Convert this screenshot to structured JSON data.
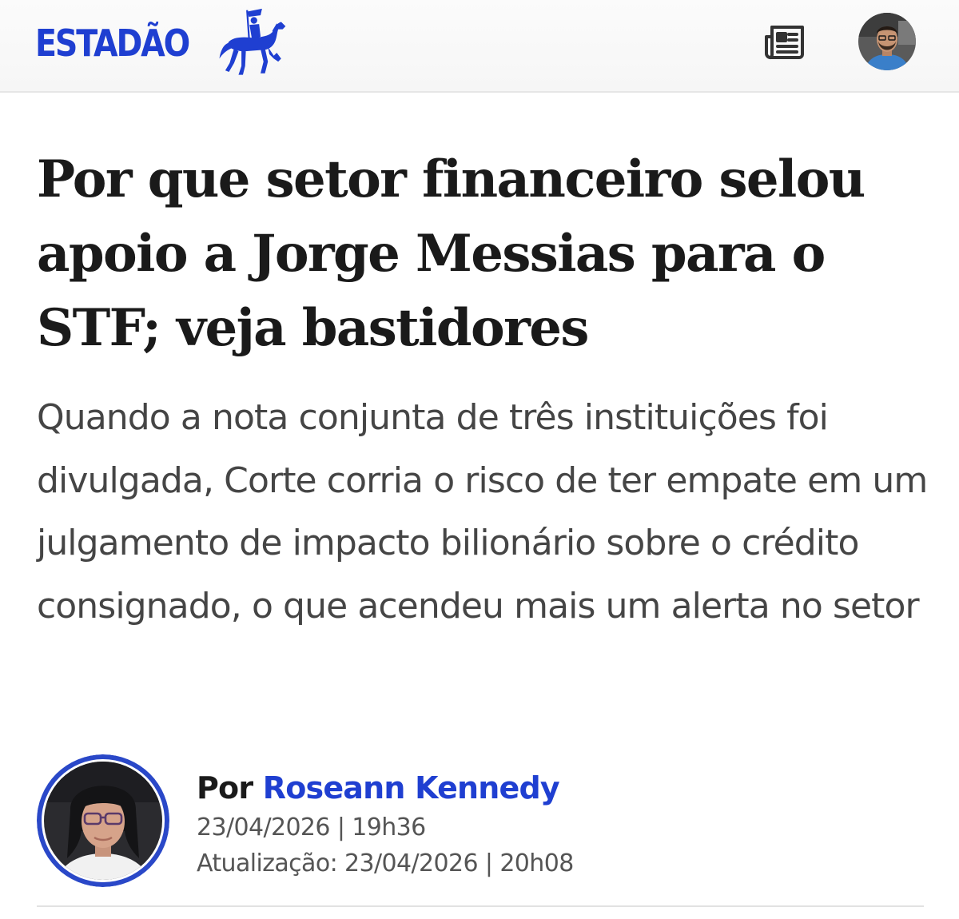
{
  "header": {
    "brand": "ESTADÃO",
    "brand_color": "#1f3fd1",
    "logo_icon": "horse-rider-icon",
    "newspaper_icon": "newspaper-icon",
    "profile_avatar": "user-avatar"
  },
  "article": {
    "headline": "Por que setor financeiro selou apoio a Jorge Messias para o STF; veja bastidores",
    "subtitle": "Quando a nota conjunta de três instituições foi divulgada, Corte corria o risco de ter empate em um julgamento de impacto bilionário sobre o crédito consignado, o que acendeu mais um alerta no setor"
  },
  "byline": {
    "prefix": "Por",
    "author": "Roseann Kennedy",
    "author_color": "#1f3fd1",
    "published": "23/04/2026 | 19h36",
    "updated": "Atualização: 23/04/2026 | 20h08"
  }
}
